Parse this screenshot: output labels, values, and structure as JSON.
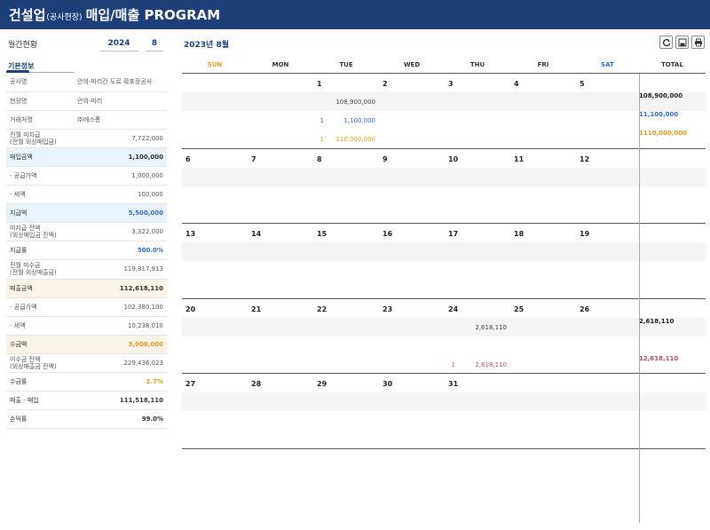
{
  "header": {
    "title_main": "건설업",
    "title_sub": "(공사현장)",
    "title_rest": "매입/매출 PROGRAM"
  },
  "left": {
    "period_label": "월간현황",
    "year": "2024",
    "month": "8",
    "tab_label": "기본정보",
    "rows": [
      {
        "k": "공사명",
        "v": "안의-마리간 도로 확포장공사"
      },
      {
        "k": "현장명",
        "v": "안의-마리"
      },
      {
        "k": "거래처명",
        "v": "㈜에스롱"
      },
      {
        "k": "전월 미지급\n(전월 외상매입금)",
        "v": "7,722,000"
      },
      {
        "k": "매입금액",
        "v": "1,100,000"
      },
      {
        "k": " - 공급가액",
        "v": "1,000,000"
      },
      {
        "k": " - 세액",
        "v": "100,000"
      },
      {
        "k": "지급액",
        "v": "5,500,000"
      },
      {
        "k": "미지급 잔액\n(외상매입금 잔액)",
        "v": "3,322,000"
      },
      {
        "k": "지급률",
        "v": "500.0%"
      },
      {
        "k": "전월 미수금\n(전월 외상매출금)",
        "v": "119,817,913"
      },
      {
        "k": "매출금액",
        "v": "112,618,110"
      },
      {
        "k": " - 공급가액",
        "v": "102,380,100"
      },
      {
        "k": " - 세액",
        "v": "10,238,010"
      },
      {
        "k": "수금액",
        "v": "3,000,000"
      },
      {
        "k": "미수금 잔액\n(외상매출금 잔액)",
        "v": "229,436,023"
      },
      {
        "k": "수금률",
        "v": "2.7%"
      },
      {
        "k": "매출 - 매입",
        "v": "111,518,110"
      },
      {
        "k": "손익률",
        "v": "99.0%"
      }
    ]
  },
  "calendar": {
    "title": "2023년 8월",
    "toolbar": {
      "refresh_icon": "refresh-icon",
      "save_icon": "save-icon",
      "print_icon": "print-icon"
    },
    "days_header": [
      "SUN",
      "MON",
      "TUE",
      "WED",
      "THU",
      "FRI",
      "SAT",
      "TOTAL"
    ],
    "weeks": [
      {
        "days": [
          "",
          "",
          "1",
          "2",
          "3",
          "4",
          "5"
        ]
      },
      {
        "days": [
          "6",
          "7",
          "8",
          "9",
          "10",
          "11",
          "12"
        ]
      },
      {
        "days": [
          "13",
          "14",
          "15",
          "16",
          "17",
          "18",
          "19"
        ]
      },
      {
        "days": [
          "20",
          "21",
          "22",
          "23",
          "24",
          "25",
          "26"
        ]
      },
      {
        "days": [
          "27",
          "28",
          "29",
          "30",
          "31",
          "",
          ""
        ]
      }
    ],
    "entries": {
      "w1_tue_sales": "108,900,000",
      "w1_total_sales": "108,900,000",
      "w1_tue_buy_cnt": "1",
      "w1_tue_buy_amt": "1,100,000",
      "w1_total_buy_cnt": "1",
      "w1_total_buy_amt": "1,100,000",
      "w1_tue_pay_cnt": "1",
      "w1_tue_pay_amt": "110,000,000",
      "w1_total_pay_cnt": "1",
      "w1_total_pay_amt": "110,000,000",
      "w4_thu_sales": "2,618,110",
      "w4_total_sales": "2,618,110",
      "w4_thu_col_cnt": "1",
      "w4_thu_col_amt": "2,618,110",
      "w4_total_col_cnt": "1",
      "w4_total_col_amt": "2,618,110"
    },
    "colors": {
      "blue": "#2f6ac6",
      "orange": "#e39a1c",
      "maroon": "#b2505e",
      "navy": "#1c3f7a"
    }
  }
}
